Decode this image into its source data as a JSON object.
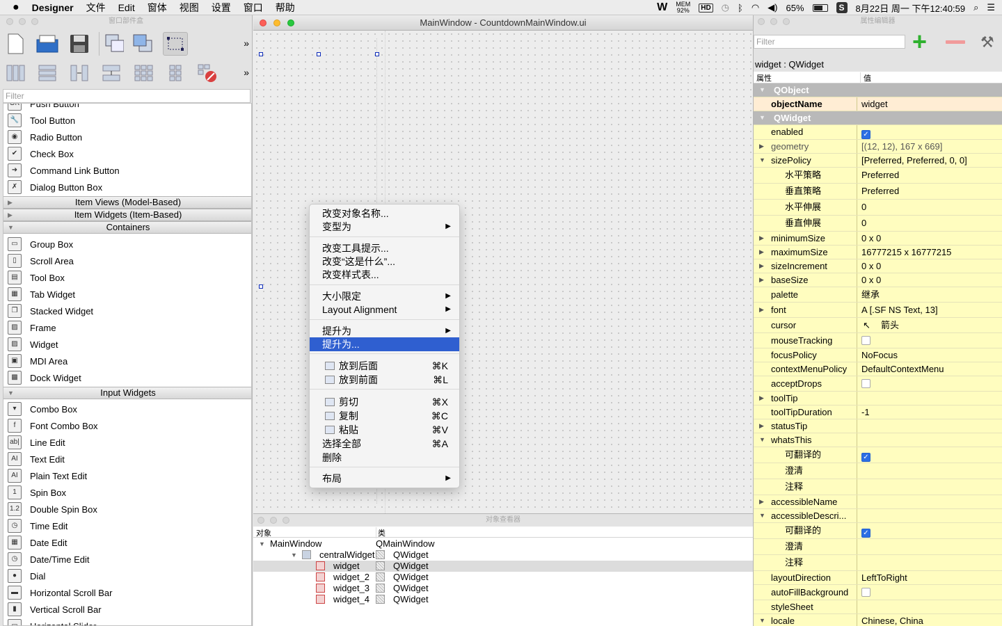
{
  "menubar": {
    "app": "Designer",
    "items": [
      "文件",
      "Edit",
      "窗体",
      "视图",
      "设置",
      "窗口",
      "帮助"
    ],
    "status": {
      "mem_label": "MEM",
      "mem_value": "92%",
      "hd": "HD",
      "battery": "65%",
      "datetime": "8月22日 周一 下午12:40:59"
    }
  },
  "widgetbox": {
    "title": "窗口部件盒",
    "filter_placeholder": "Filter",
    "items_top": [
      {
        "label": "Push Button",
        "icon": "push-button-icon",
        "glyph": "OK"
      },
      {
        "label": "Tool Button",
        "icon": "tool-button-icon",
        "glyph": "🔧"
      },
      {
        "label": "Radio Button",
        "icon": "radio-button-icon",
        "glyph": "◉"
      },
      {
        "label": "Check Box",
        "icon": "check-box-icon",
        "glyph": "✔"
      },
      {
        "label": "Command Link Button",
        "icon": "command-link-icon",
        "glyph": "➜"
      },
      {
        "label": "Dialog Button Box",
        "icon": "dialog-button-box-icon",
        "glyph": "✗"
      }
    ],
    "categories": {
      "item_views": "Item Views (Model-Based)",
      "item_widgets": "Item Widgets (Item-Based)",
      "containers": "Containers",
      "input_widgets": "Input Widgets"
    },
    "containers": [
      {
        "label": "Group Box",
        "icon": "group-box-icon",
        "glyph": "▭"
      },
      {
        "label": "Scroll Area",
        "icon": "scroll-area-icon",
        "glyph": "▯"
      },
      {
        "label": "Tool Box",
        "icon": "tool-box-icon",
        "glyph": "▤"
      },
      {
        "label": "Tab Widget",
        "icon": "tab-widget-icon",
        "glyph": "▦"
      },
      {
        "label": "Stacked Widget",
        "icon": "stacked-widget-icon",
        "glyph": "❐"
      },
      {
        "label": "Frame",
        "icon": "frame-icon",
        "glyph": "▨"
      },
      {
        "label": "Widget",
        "icon": "widget-icon",
        "glyph": "▨"
      },
      {
        "label": "MDI Area",
        "icon": "mdi-area-icon",
        "glyph": "▣"
      },
      {
        "label": "Dock Widget",
        "icon": "dock-widget-icon",
        "glyph": "▩"
      }
    ],
    "inputs": [
      {
        "label": "Combo Box",
        "icon": "combo-box-icon",
        "glyph": "▾"
      },
      {
        "label": "Font Combo Box",
        "icon": "font-combo-box-icon",
        "glyph": "f"
      },
      {
        "label": "Line Edit",
        "icon": "line-edit-icon",
        "glyph": "ab|"
      },
      {
        "label": "Text Edit",
        "icon": "text-edit-icon",
        "glyph": "AI"
      },
      {
        "label": "Plain Text Edit",
        "icon": "plain-text-edit-icon",
        "glyph": "AI"
      },
      {
        "label": "Spin Box",
        "icon": "spin-box-icon",
        "glyph": "1"
      },
      {
        "label": "Double Spin Box",
        "icon": "double-spin-box-icon",
        "glyph": "1.2"
      },
      {
        "label": "Time Edit",
        "icon": "time-edit-icon",
        "glyph": "◷"
      },
      {
        "label": "Date Edit",
        "icon": "date-edit-icon",
        "glyph": "▦"
      },
      {
        "label": "Date/Time Edit",
        "icon": "datetime-edit-icon",
        "glyph": "◷"
      },
      {
        "label": "Dial",
        "icon": "dial-icon",
        "glyph": "●"
      },
      {
        "label": "Horizontal Scroll Bar",
        "icon": "hscrollbar-icon",
        "glyph": "▬"
      },
      {
        "label": "Vertical Scroll Bar",
        "icon": "vscrollbar-icon",
        "glyph": "▮"
      },
      {
        "label": "Horizontal Slider",
        "icon": "hslider-icon",
        "glyph": "▭"
      }
    ]
  },
  "form": {
    "title": "MainWindow - CountdownMainWindow.ui"
  },
  "context_menu": {
    "items": [
      {
        "label": "改变对象名称...",
        "arrow": "",
        "shortcut": ""
      },
      {
        "label": "变型为",
        "arrow": "▶",
        "shortcut": ""
      },
      {
        "label": "改变工具提示...",
        "arrow": "",
        "shortcut": ""
      },
      {
        "label": "改变“这是什么”...",
        "arrow": "",
        "shortcut": ""
      },
      {
        "label": "改变样式表...",
        "arrow": "",
        "shortcut": ""
      },
      {
        "label": "大小限定",
        "arrow": "▶",
        "shortcut": ""
      },
      {
        "label": "Layout Alignment",
        "arrow": "▶",
        "shortcut": ""
      },
      {
        "label": "提升为",
        "arrow": "▶",
        "shortcut": ""
      },
      {
        "label": "提升为...",
        "arrow": "",
        "shortcut": ""
      },
      {
        "label": "放到后面",
        "arrow": "",
        "shortcut": "⌘K"
      },
      {
        "label": "放到前面",
        "arrow": "",
        "shortcut": "⌘L"
      },
      {
        "label": "剪切",
        "arrow": "",
        "shortcut": "⌘X"
      },
      {
        "label": "复制",
        "arrow": "",
        "shortcut": "⌘C"
      },
      {
        "label": "粘贴",
        "arrow": "",
        "shortcut": "⌘V"
      },
      {
        "label": "选择全部",
        "arrow": "",
        "shortcut": "⌘A"
      },
      {
        "label": "删除",
        "arrow": "",
        "shortcut": ""
      },
      {
        "label": "布局",
        "arrow": "▶",
        "shortcut": ""
      }
    ]
  },
  "object_inspector": {
    "title": "对象查看器",
    "col_object": "对象",
    "col_class": "类",
    "rows": [
      {
        "name": "MainWindow",
        "cls": "QMainWindow"
      },
      {
        "name": "centralWidget",
        "cls": "QWidget"
      },
      {
        "name": "widget",
        "cls": "QWidget"
      },
      {
        "name": "widget_2",
        "cls": "QWidget"
      },
      {
        "name": "widget_3",
        "cls": "QWidget"
      },
      {
        "name": "widget_4",
        "cls": "QWidget"
      }
    ]
  },
  "property_editor": {
    "title": "属性编辑器",
    "filter_placeholder": "Filter",
    "object_label": "widget : QWidget",
    "col_property": "属性",
    "col_value": "值",
    "rows": [
      {
        "k": "QObject",
        "v": ""
      },
      {
        "k": "objectName",
        "v": "widget"
      },
      {
        "k": "QWidget",
        "v": ""
      },
      {
        "k": "enabled",
        "v": ""
      },
      {
        "k": "geometry",
        "v": "[(12, 12), 167 x 669]"
      },
      {
        "k": "sizePolicy",
        "v": "[Preferred, Preferred, 0, 0]"
      },
      {
        "k": "水平策略",
        "v": "Preferred"
      },
      {
        "k": "垂直策略",
        "v": "Preferred"
      },
      {
        "k": "水平伸展",
        "v": "0"
      },
      {
        "k": "垂直伸展",
        "v": "0"
      },
      {
        "k": "minimumSize",
        "v": "0 x 0"
      },
      {
        "k": "maximumSize",
        "v": "16777215 x 16777215"
      },
      {
        "k": "sizeIncrement",
        "v": "0 x 0"
      },
      {
        "k": "baseSize",
        "v": "0 x 0"
      },
      {
        "k": "palette",
        "v": "继承"
      },
      {
        "k": "font",
        "v": "A   [.SF NS Text, 13]"
      },
      {
        "k": "cursor",
        "v": "箭头"
      },
      {
        "k": "mouseTracking",
        "v": ""
      },
      {
        "k": "focusPolicy",
        "v": "NoFocus"
      },
      {
        "k": "contextMenuPolicy",
        "v": "DefaultContextMenu"
      },
      {
        "k": "acceptDrops",
        "v": ""
      },
      {
        "k": "toolTip",
        "v": ""
      },
      {
        "k": "toolTipDuration",
        "v": "-1"
      },
      {
        "k": "statusTip",
        "v": ""
      },
      {
        "k": "whatsThis",
        "v": ""
      },
      {
        "k": "可翻译的",
        "v": ""
      },
      {
        "k": "澄清",
        "v": ""
      },
      {
        "k": "注释",
        "v": ""
      },
      {
        "k": "accessibleName",
        "v": ""
      },
      {
        "k": "accessibleDescri...",
        "v": ""
      },
      {
        "k": "可翻译的",
        "v": ""
      },
      {
        "k": "澄清",
        "v": ""
      },
      {
        "k": "注释",
        "v": ""
      },
      {
        "k": "layoutDirection",
        "v": "LeftToRight"
      },
      {
        "k": "autoFillBackground",
        "v": ""
      },
      {
        "k": "styleSheet",
        "v": ""
      },
      {
        "k": "locale",
        "v": "Chinese, China"
      }
    ]
  },
  "colors": {
    "selection": "#2f5fd0",
    "prop_yellow": "#fffdbf",
    "prop_orange": "#ffedd4",
    "group_gray": "#b9b9b9"
  }
}
